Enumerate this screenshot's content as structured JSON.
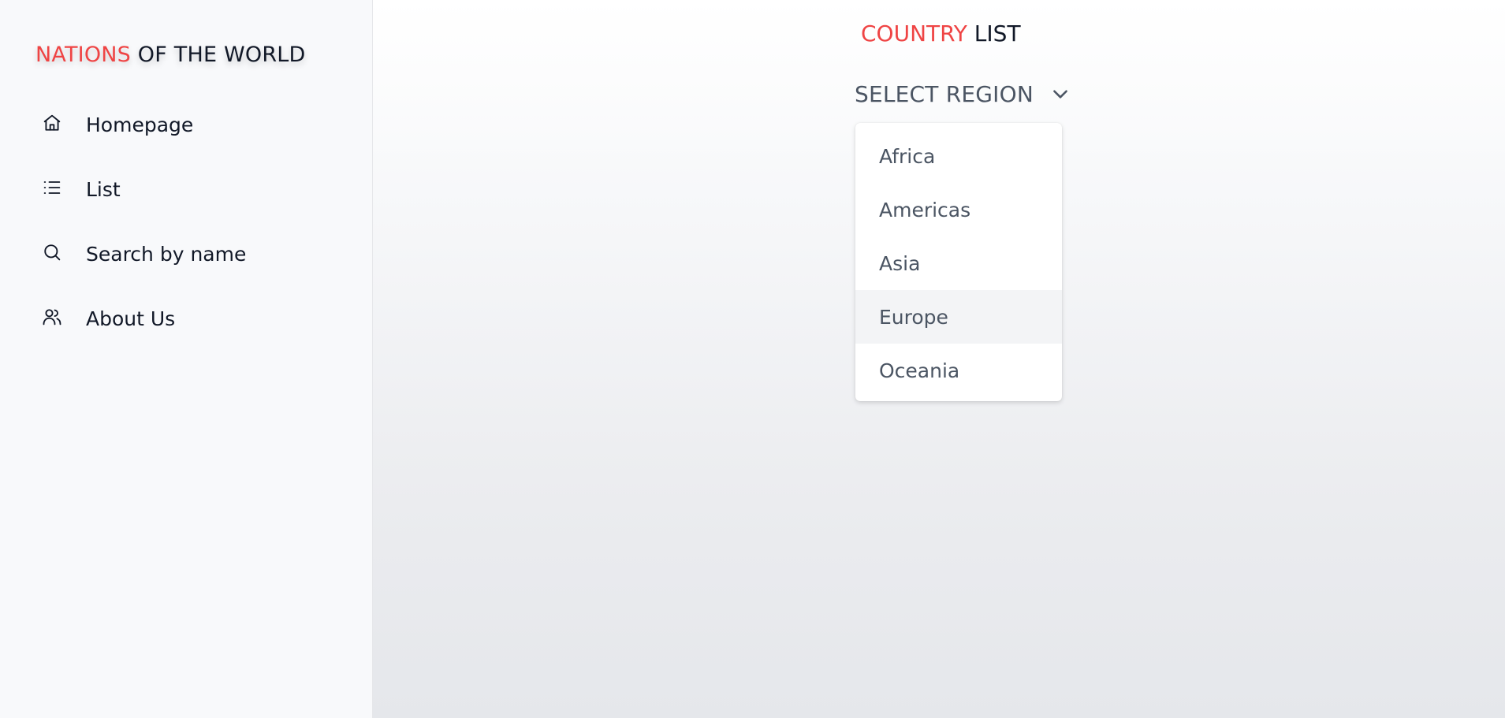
{
  "brand": {
    "accent": "NATIONS",
    "rest": " OF THE WORLD"
  },
  "sidebar": {
    "items": [
      {
        "label": "Homepage",
        "icon": "home-icon"
      },
      {
        "label": "List",
        "icon": "list-icon"
      },
      {
        "label": "Search by name",
        "icon": "search-icon"
      },
      {
        "label": "About Us",
        "icon": "users-icon"
      }
    ]
  },
  "main": {
    "title_accent": "COUNTRY",
    "title_rest": " LIST",
    "select": {
      "label": "SELECT REGION",
      "icon": "chevron-down-icon"
    },
    "dropdown": {
      "options": [
        "Africa",
        "Americas",
        "Asia",
        "Europe",
        "Oceania"
      ],
      "highlighted": "Europe"
    }
  },
  "colors": {
    "accent": "#ef4444",
    "text": "#111827",
    "muted": "#4b5563",
    "sidebar_bg": "#f8f9fb",
    "highlight": "#f3f4f6"
  }
}
